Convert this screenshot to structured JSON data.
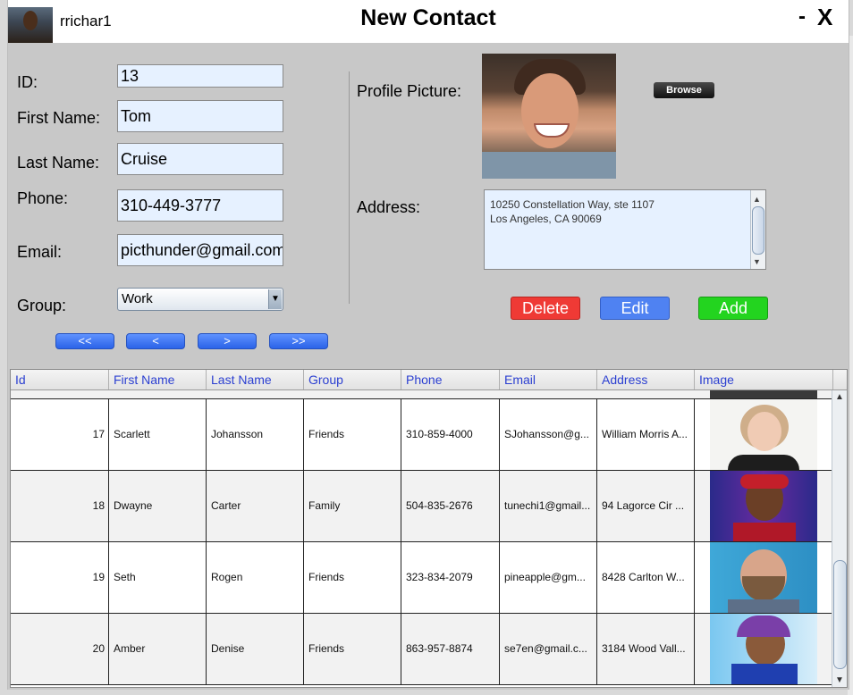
{
  "titlebar": {
    "username": "rrichar1",
    "title": "New Contact",
    "minimize": "-",
    "close": "X"
  },
  "form": {
    "id_label": "ID:",
    "id_value": "13",
    "first_name_label": "First Name:",
    "first_name_value": "Tom",
    "last_name_label": "Last Name:",
    "last_name_value": "Cruise",
    "phone_label": "Phone:",
    "phone_value": "310-449-3777",
    "email_label": "Email:",
    "email_value": "picthunder@gmail.com",
    "group_label": "Group:",
    "group_value": "Work",
    "profile_label": "Profile Picture:",
    "browse_label": "Browse",
    "address_label": "Address:",
    "address_line1": "10250 Constellation Way, ste 1107",
    "address_line2": "Los Angeles, CA 90069"
  },
  "nav": {
    "first": "<<",
    "prev": "<",
    "next": ">",
    "last": ">>"
  },
  "actions": {
    "delete": "Delete",
    "edit": "Edit",
    "add": "Add"
  },
  "colors": {
    "delete": "#ef3a35",
    "edit": "#4f82f2",
    "add": "#23d41f",
    "header_text": "#2b3fd1"
  },
  "table": {
    "columns": [
      "Id",
      "First Name",
      "Last Name",
      "Group",
      "Phone",
      "Email",
      "Address",
      "Image"
    ],
    "rows": [
      {
        "id": "17",
        "first": "Scarlett",
        "last": "Johansson",
        "group": "Friends",
        "phone": "310-859-4000",
        "email": "SJohansson@g...",
        "address": "William Morris A..."
      },
      {
        "id": "18",
        "first": "Dwayne",
        "last": "Carter",
        "group": "Family",
        "phone": "504-835-2676",
        "email": "tunechi1@gmail...",
        "address": "94 Lagorce Cir ..."
      },
      {
        "id": "19",
        "first": "Seth",
        "last": "Rogen",
        "group": "Friends",
        "phone": "323-834-2079",
        "email": "pineapple@gm...",
        "address": "8428 Carlton W..."
      },
      {
        "id": "20",
        "first": "Amber",
        "last": "Denise",
        "group": "Friends",
        "phone": "863-957-8874",
        "email": "se7en@gmail.c...",
        "address": "3184 Wood Vall..."
      }
    ]
  }
}
